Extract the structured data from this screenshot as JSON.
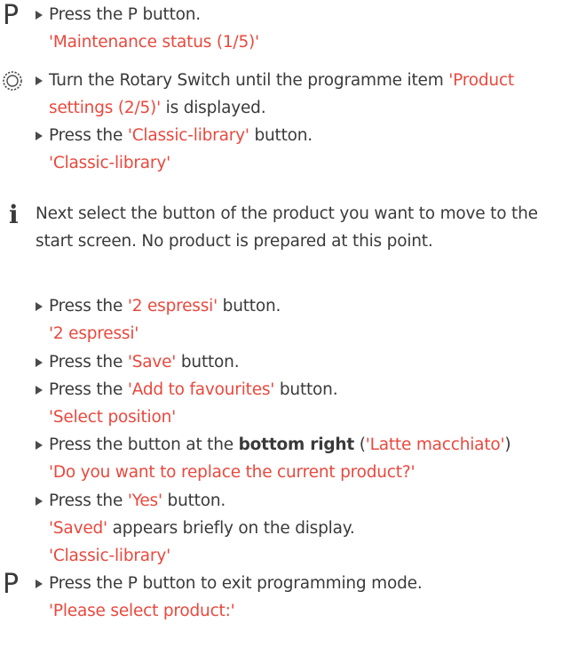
{
  "steps": {
    "s1": {
      "icon_text": "P",
      "text": "Press the P button.",
      "result": "'Maintenance status (1/5)'"
    },
    "s2": {
      "icon_name": "rotary-switch-icon",
      "line1_pre": "Turn the Rotary Switch until the programme item ",
      "line1_red": "'Product",
      "line2_red": "settings (2/5)'",
      "line2_post": " is displayed."
    },
    "s3": {
      "pre": "Press the ",
      "red": "'Classic-library'",
      "post": " button.",
      "result": "'Classic-library'"
    },
    "info": {
      "icon_text": "i",
      "line1": "Next select the button of the product you want to move to the",
      "line2": "start screen. No product is prepared at this point."
    },
    "s4": {
      "pre": "Press the ",
      "red": "'2 espressi'",
      "post": " button.",
      "result": "'2 espressi'"
    },
    "s5": {
      "pre": "Press the ",
      "red": "'Save'",
      "post": " button."
    },
    "s6": {
      "pre": "Press the ",
      "red": "'Add to favourites'",
      "post": " button.",
      "result": "'Select position'"
    },
    "s7": {
      "pre": "Press the button at the ",
      "bold": "bottom right",
      "paren_open": " (",
      "red": "'Latte macchiato'",
      "paren_close": ")",
      "result": "'Do you want to replace the current product?'"
    },
    "s8": {
      "pre": "Press the ",
      "red": "'Yes'",
      "post": " button.",
      "saved_red": "'Saved'",
      "saved_post": " appears briefly on the display.",
      "result": "'Classic-library'"
    },
    "s9": {
      "icon_text": "P",
      "text": "Press the P button to exit programming mode.",
      "result": "'Please select product:'"
    }
  }
}
